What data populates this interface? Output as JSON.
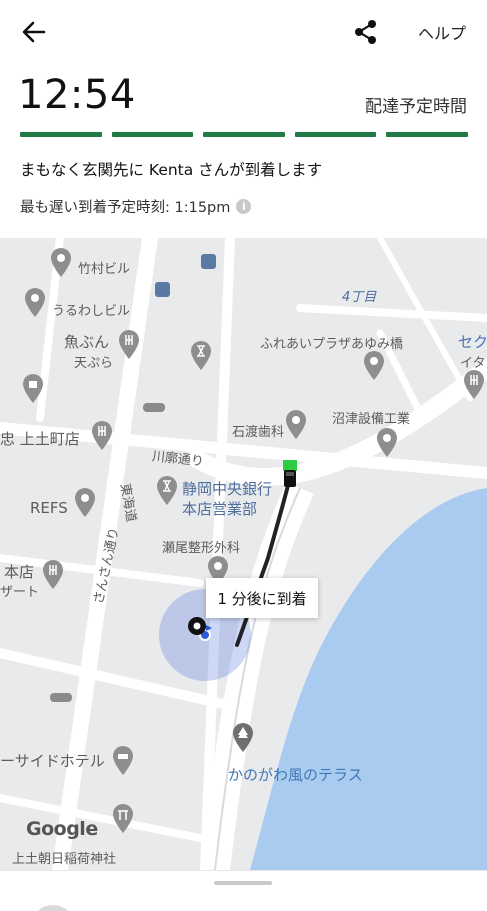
{
  "header": {
    "back_icon": "arrow-left-icon",
    "share_icon": "share-icon",
    "help_label": "ヘルプ"
  },
  "eta": {
    "time": "12:54",
    "label": "配達予定時間",
    "progress_segments": 5,
    "progress_color": "#1f7a44"
  },
  "status": {
    "message": "まもなく玄関先に Kenta さんが到着します",
    "latest_arrival": "最も遅い到着予定時刻: 1:15pm",
    "info_icon": "info-icon"
  },
  "map": {
    "labels": {
      "takemura": "竹村ビル",
      "uruwashi": "うるわしビル",
      "uoban": "魚ぶん",
      "tempura": "天ぷら",
      "chome4": "4丁目",
      "fureai": "ふれあいプラザあゆみ橋",
      "seku": "セク",
      "ita": "イタ",
      "ishiwata": "石渡歯科",
      "numazu": "沼津設備工業",
      "kamitsuchi": "忠 上土町店",
      "kawabata": "川廓通り",
      "tokaido": "東海道",
      "shizuoka1": "静岡中央銀行",
      "shizuoka2": "本店営業部",
      "refs": "REFS",
      "seo": "瀬尾整形外科",
      "sansun": "さんさん通り",
      "honten": "本店",
      "zato": "ザート",
      "hotel": "ーサイドホテル",
      "kanogawa": "かのがわ風のテラス",
      "shrine": "上土朝日稲荷神社",
      "google": "Google"
    },
    "arrival_bubble": "1 分後に到着",
    "route_color": "#222222",
    "water_color": "#a9cbef",
    "destination_circle_color": "#4d6fe0"
  },
  "sheet": {
    "handle": "drag-handle"
  }
}
